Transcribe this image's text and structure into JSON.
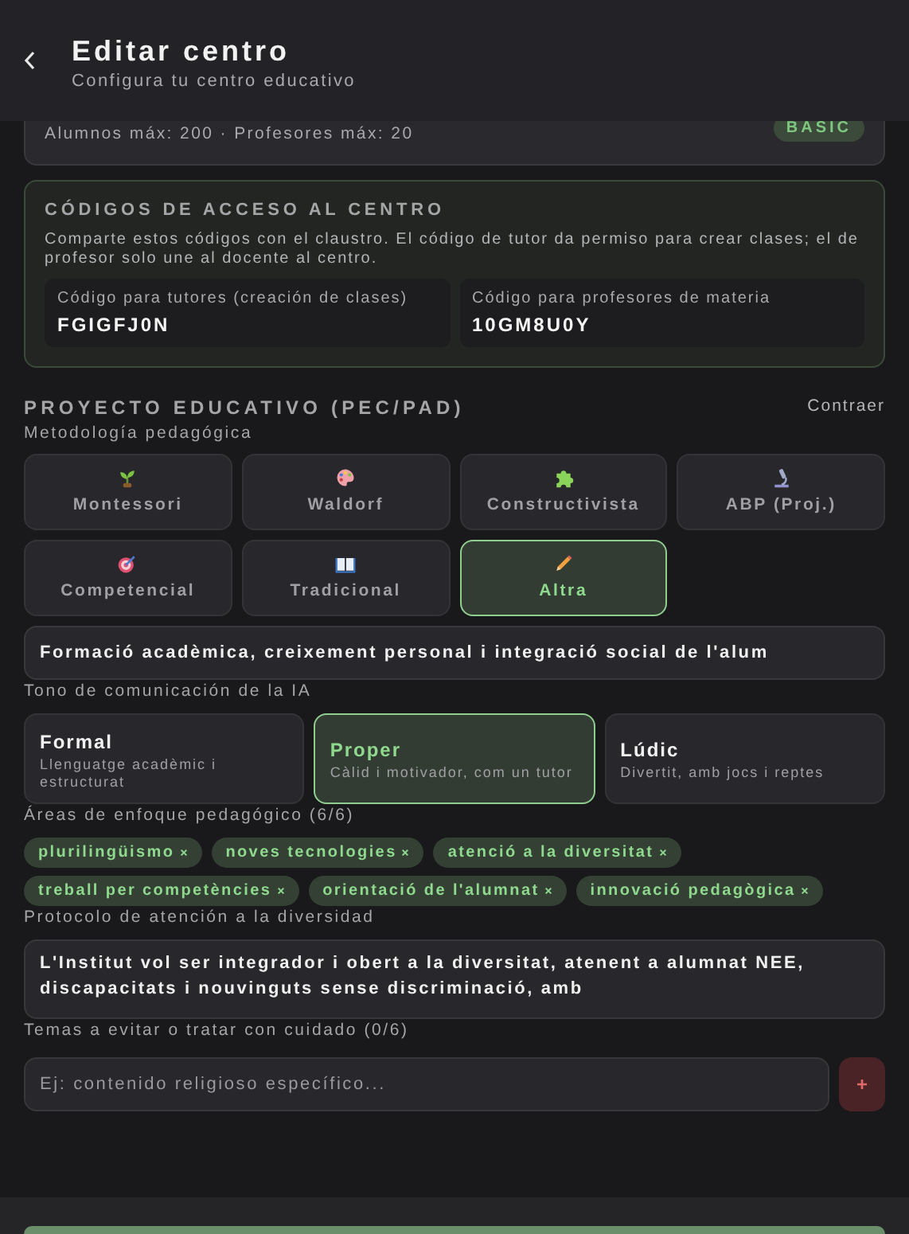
{
  "header": {
    "title": "Editar centro",
    "subtitle": "Configura tu centro educativo"
  },
  "plan_card": {
    "limits": "Alumnos máx: 200 · Profesores máx: 20",
    "badge": "BASIC"
  },
  "access_codes": {
    "title": "CÓDIGOS DE ACCESO AL CENTRO",
    "description": "Comparte estos códigos con el claustro. El código de tutor da permiso para crear clases; el de profesor solo une al docente al centro.",
    "codes": [
      {
        "label": "Código para tutores (creación de clases)",
        "value": "FGIGFJ0N"
      },
      {
        "label": "Código para profesores de materia",
        "value": "10GM8U0Y"
      }
    ]
  },
  "project": {
    "title": "PROYECTO EDUCATIVO (PEC/PAD)",
    "toggle": "Contraer",
    "methodology_label": "Metodología pedagógica",
    "methodologies": [
      {
        "label": "Montessori",
        "selected": false
      },
      {
        "label": "Waldorf",
        "selected": false
      },
      {
        "label": "Constructivista",
        "selected": false
      },
      {
        "label": "ABP (Proj.)",
        "selected": false
      },
      {
        "label": "Competencial",
        "selected": false
      },
      {
        "label": "Tradicional",
        "selected": false
      },
      {
        "label": "Altra",
        "selected": true
      }
    ],
    "methodology_other": "Formació acadèmica, creixement personal i integració social de l'alum",
    "tone_label": "Tono de comunicación de la IA",
    "tones": [
      {
        "title": "Formal",
        "description": "Llenguatge acadèmic i estructurat",
        "selected": false
      },
      {
        "title": "Proper",
        "description": "Càlid i motivador, com un tutor",
        "selected": true
      },
      {
        "title": "Lúdic",
        "description": "Divertit, amb jocs i reptes",
        "selected": false
      }
    ],
    "areas_label": "Áreas de enfoque pedagógico (6/6)",
    "areas": [
      "plurilingüismo",
      "noves tecnologies",
      "atenció a la diversitat",
      "treball per competències",
      "orientació de l'alumnat",
      "innovació pedagògica"
    ],
    "diversity_label": "Protocolo de atención a la diversidad",
    "diversity_text": "L'Institut vol ser integrador i obert a la diversitat, atenent a alumnat NEE, discapacitats i nouvinguts sense discriminació, amb",
    "avoid_label": "Temas a evitar o tratar con cuidado (0/6)",
    "avoid_placeholder": "Ej: contenido religioso específico...",
    "add_button": "+"
  }
}
